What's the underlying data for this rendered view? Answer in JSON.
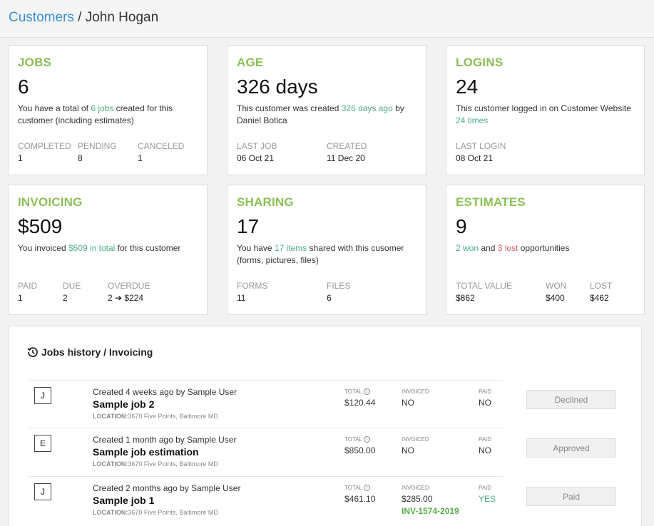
{
  "breadcrumb": {
    "parent": "Customers",
    "separator": " / ",
    "current": "John Hogan"
  },
  "cards": {
    "jobs": {
      "title": "JOBS",
      "big": "6",
      "desc_pre": "You have a total of ",
      "desc_link": "6 jobs",
      "desc_post": " created for this customer (including estimates)",
      "stats": [
        {
          "label": "COMPLETED",
          "value": "1"
        },
        {
          "label": "PENDING",
          "value": "8"
        },
        {
          "label": "CANCELED",
          "value": "1"
        }
      ]
    },
    "age": {
      "title": "AGE",
      "big": "326 days",
      "desc_pre": "This customer was created ",
      "desc_link": "326 days ago",
      "desc_post": " by Daniel Botica",
      "stats": [
        {
          "label": "LAST JOB",
          "value": "06 Oct 21"
        },
        {
          "label": "CREATED",
          "value": "11 Dec 20"
        }
      ]
    },
    "logins": {
      "title": "LOGINS",
      "big": "24",
      "desc_pre": "This customer logged in on Customer Website ",
      "desc_link": "24 times",
      "stats": [
        {
          "label": "LAST LOGIN",
          "value": "08 Oct 21"
        }
      ]
    },
    "invoicing": {
      "title": "INVOICING",
      "big": "$509",
      "desc_pre": "You invoiced ",
      "desc_link": "$509 in total",
      "desc_post": " for this customer",
      "stats": [
        {
          "label": "PAID",
          "value": "1"
        },
        {
          "label": "DUE",
          "value": "2"
        },
        {
          "label": "OVERDUE",
          "value": "2 ➔ $224"
        }
      ]
    },
    "sharing": {
      "title": "SHARING",
      "big": "17",
      "desc_pre": "You have ",
      "desc_link": "17 items",
      "desc_post": " shared with this cusomer (forms, pictures, files)",
      "stats": [
        {
          "label": "FORMS",
          "value": "11"
        },
        {
          "label": "FILES",
          "value": "6"
        }
      ]
    },
    "estimates": {
      "title": "ESTIMATES",
      "big": "9",
      "desc_won": "2 won",
      "desc_mid": " and ",
      "desc_lost": "3 lost",
      "desc_post": " opportunities",
      "stats": [
        {
          "label": "TOTAL VALUE",
          "value": "$862"
        },
        {
          "label": "WON",
          "value": "$400"
        },
        {
          "label": "LOST",
          "value": "$462"
        }
      ]
    }
  },
  "history": {
    "title": "Jobs history / Invoicing",
    "columns": {
      "total": "TOTAL",
      "invoiced": "INVOICED",
      "paid": "PAID"
    },
    "location_label": "LOCATION:",
    "rows": [
      {
        "badge": "J",
        "created": "Created 4 weeks ago by Sample User",
        "name": "Sample job 2",
        "location": "3670 Five Points, Baltimore MD",
        "total": "$120.44",
        "invoiced": "NO",
        "invoice_id": "",
        "paid": "NO",
        "status": "Declined"
      },
      {
        "badge": "E",
        "created": "Created 1 month ago by Sample User",
        "name": "Sample job estimation",
        "location": "3670 Five Points, Baltimore MD",
        "total": "$850.00",
        "invoiced": "NO",
        "invoice_id": "",
        "paid": "NO",
        "status": "Approved"
      },
      {
        "badge": "J",
        "created": "Created 2 months ago by Sample User",
        "name": "Sample job 1",
        "location": "3670 Five Points, Baltimore MD",
        "total": "$461.10",
        "invoiced": "$285.00",
        "invoice_id": "INV-1574-2019",
        "paid": "YES",
        "status": "Paid"
      }
    ]
  },
  "colors": {
    "accent_green": "#8cbf56",
    "link_blue": "#3a8fd8",
    "positive": "#4caf82",
    "negative": "#e0566a"
  },
  "icons": {
    "history": "history-icon",
    "info": "info-icon"
  }
}
